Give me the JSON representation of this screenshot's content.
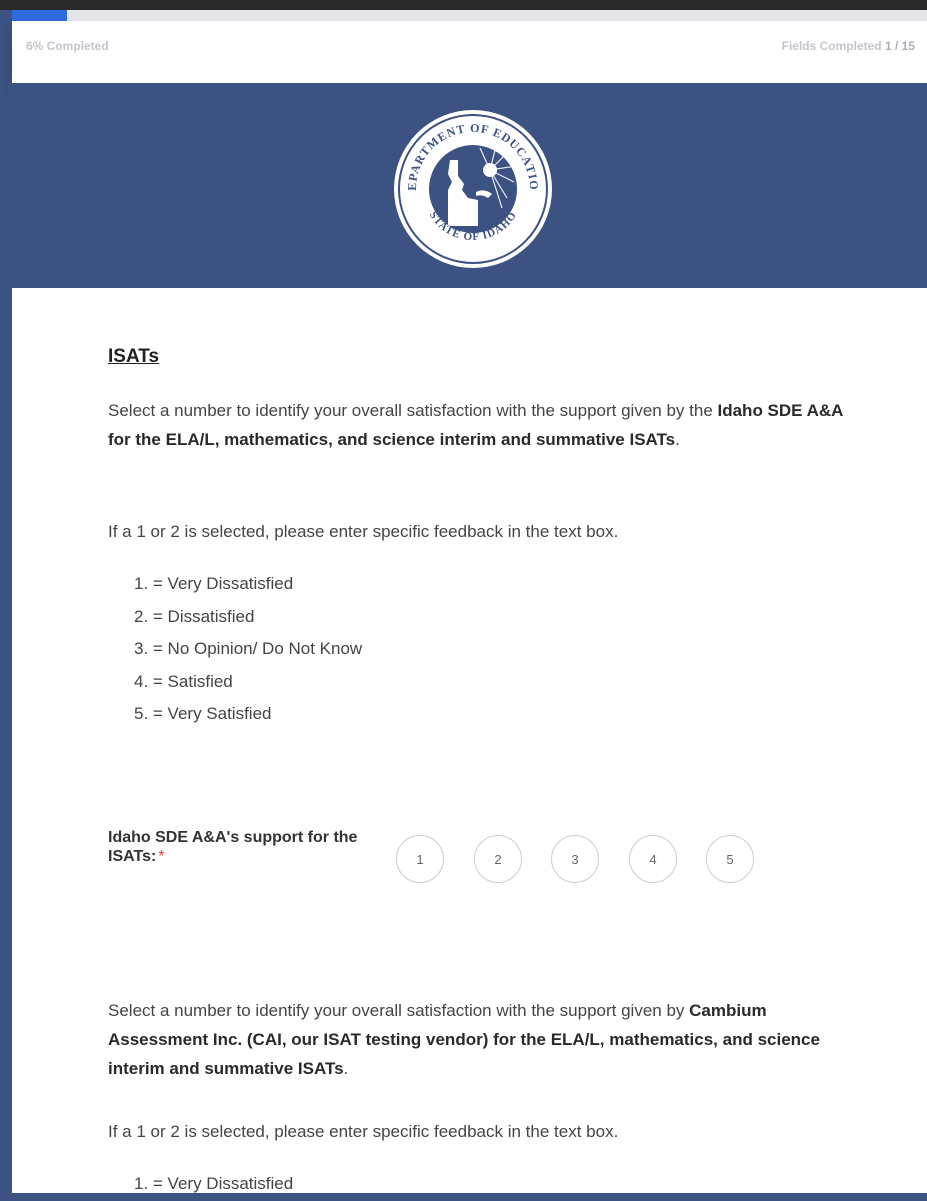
{
  "progress": {
    "percent": 6,
    "completed_label": "6% Completed",
    "fields_label": "Fields Completed",
    "fields_count": "1 / 15"
  },
  "banner": {
    "seal_top_text": "DEPARTMENT OF EDUCATION",
    "seal_bottom_text": "STATE OF IDAHO",
    "bg_color": "#3b5282"
  },
  "section": {
    "title": "ISATs"
  },
  "q1": {
    "intro_a": "Select a number to identify your overall satisfaction with the support given by the ",
    "intro_bold": "Idaho SDE A&A for the ELA/L, mathematics, and science interim and summative ISATs",
    "intro_end": ".",
    "instruction": "If a 1 or 2 is selected, please enter specific feedback in the text box.",
    "scale": [
      "1. = Very Dissatisfied",
      "2. = Dissatisfied",
      "3. = No Opinion/ Do Not Know",
      "4. = Satisfied",
      "5. = Very Satisfied"
    ],
    "field_label": "Idaho SDE A&A's support for the ISATs:",
    "required_mark": "*",
    "options": [
      "1",
      "2",
      "3",
      "4",
      "5"
    ]
  },
  "q2": {
    "intro_a": "Select a number to identify your overall satisfaction with the support given by ",
    "intro_bold": "Cambium Assessment Inc. (CAI, our ISAT testing vendor) for the ELA/L, mathematics, and science interim and summative ISATs",
    "intro_end": ".",
    "instruction": "If a 1 or 2 is selected, please enter specific feedback in the text box.",
    "scale": [
      "1. = Very Dissatisfied"
    ]
  },
  "colors": {
    "accent": "#2f6be0",
    "banner": "#3b5282",
    "required": "#e53935"
  }
}
